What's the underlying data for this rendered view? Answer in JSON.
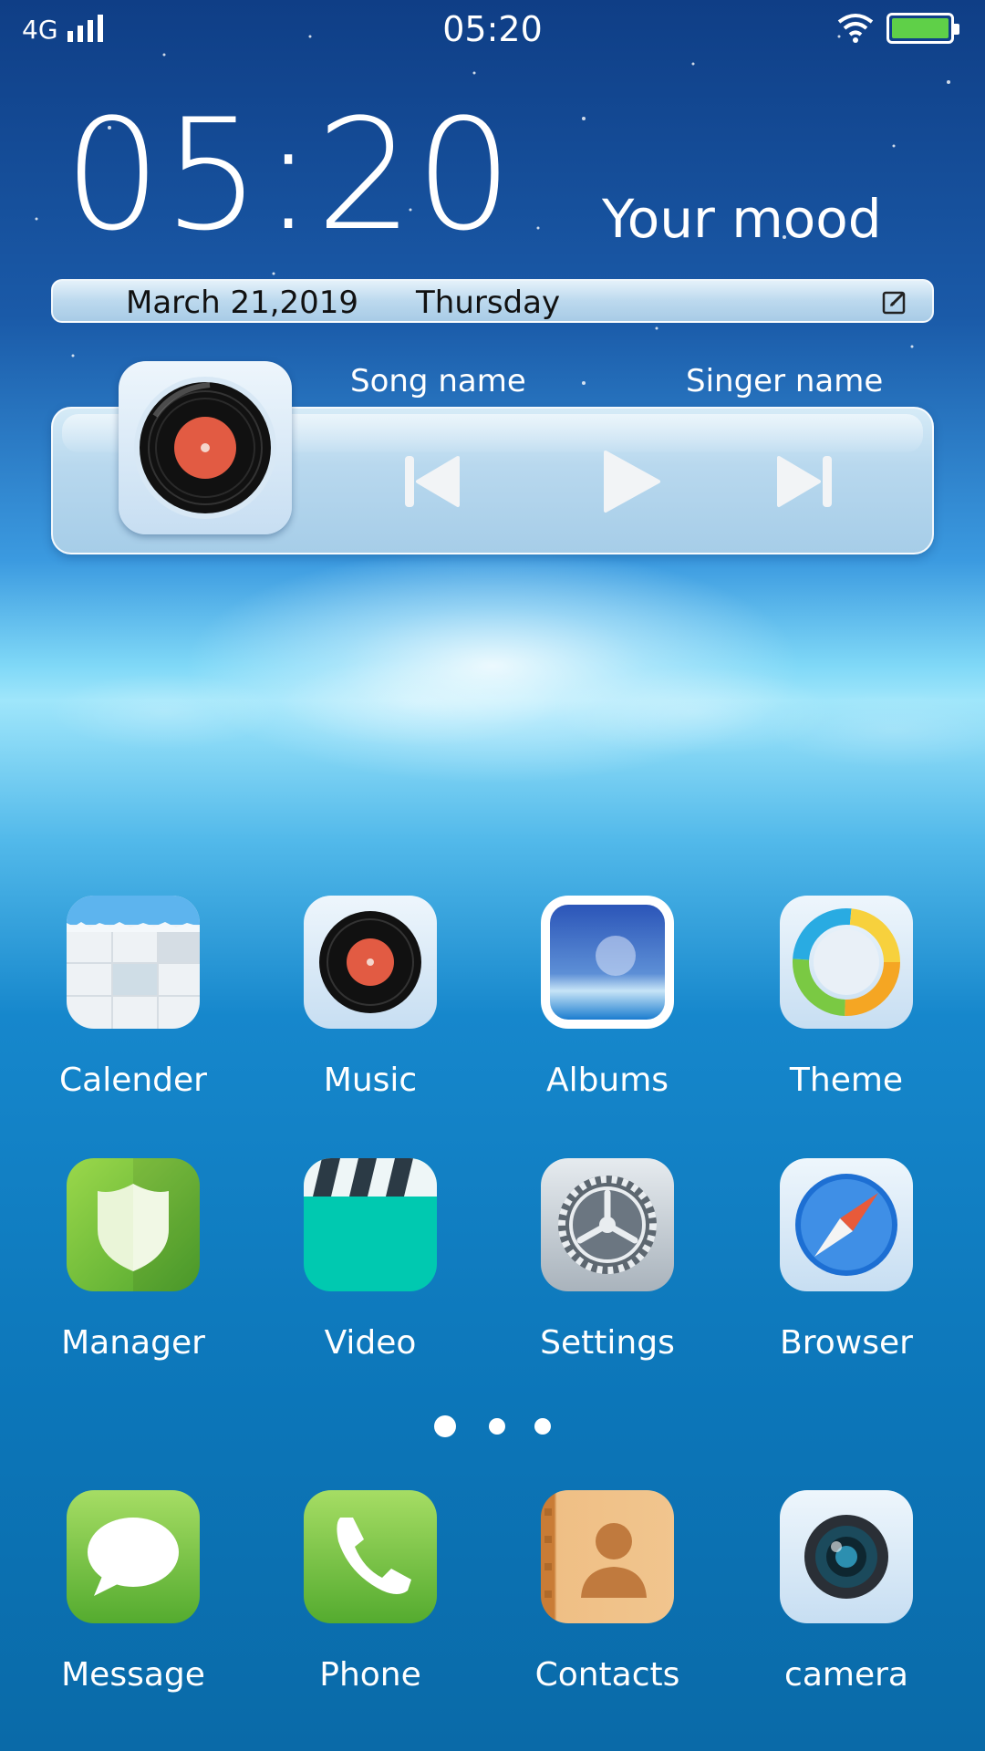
{
  "status_bar": {
    "network": "4G",
    "time": "05:20",
    "battery_level_percent": 100
  },
  "clock": {
    "time": "05:20",
    "mood": "Your mood"
  },
  "date_bar": {
    "date": "March 21,2019",
    "weekday": "Thursday"
  },
  "music": {
    "song": "Song name",
    "singer": "Singer name"
  },
  "apps": {
    "row1": [
      "Calender",
      "Music",
      "Albums",
      "Theme"
    ],
    "row2": [
      "Manager",
      "Video",
      "Settings",
      "Browser"
    ],
    "dock": [
      "Message",
      "Phone",
      "Contacts",
      "camera"
    ]
  },
  "pager": {
    "pages": 3,
    "current": 1
  },
  "colors": {
    "battery": "#5fd048",
    "vinyl_label": "#e25b43",
    "app_green": "#6ac23b",
    "video_teal": "#00c9b0"
  }
}
